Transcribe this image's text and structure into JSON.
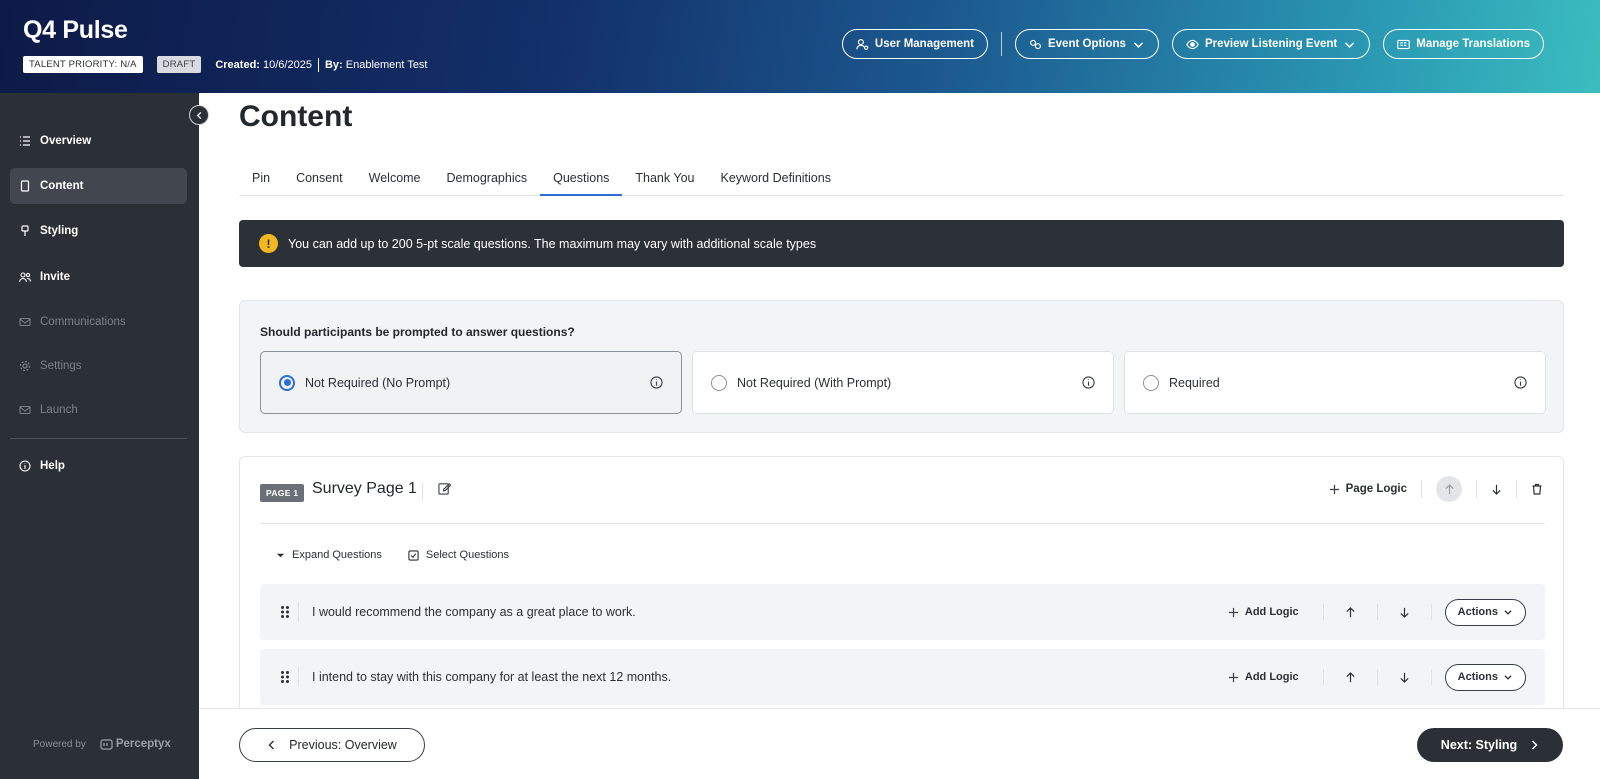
{
  "header": {
    "title": "Q4 Pulse",
    "talent_priority": "TALENT PRIORITY: N/A",
    "status": "DRAFT",
    "created_label": "Created:",
    "created_value": "10/6/2025",
    "by_label": "By:",
    "by_value": "Enablement Test",
    "buttons": {
      "user_management": "User Management",
      "event_options": "Event Options",
      "preview": "Preview Listening Event",
      "translations": "Manage Translations"
    }
  },
  "sidebar": {
    "items": [
      {
        "label": "Overview",
        "icon": "list-icon"
      },
      {
        "label": "Content",
        "icon": "document-icon"
      },
      {
        "label": "Styling",
        "icon": "brush-icon"
      },
      {
        "label": "Invite",
        "icon": "people-icon"
      },
      {
        "label": "Communications",
        "icon": "mail-icon"
      },
      {
        "label": "Settings",
        "icon": "gear-icon"
      },
      {
        "label": "Launch",
        "icon": "mail-icon"
      },
      {
        "label": "Help",
        "icon": "info-icon"
      }
    ],
    "powered_by": "Powered by",
    "brand": "Perceptyx"
  },
  "main": {
    "title": "Content",
    "tabs": [
      "Pin",
      "Consent",
      "Welcome",
      "Demographics",
      "Questions",
      "Thank You",
      "Keyword Definitions"
    ],
    "active_tab": "Questions",
    "banner": "You can add up to 200 5-pt scale questions. The maximum may vary with additional scale types",
    "prompt": {
      "question": "Should participants be prompted to answer questions?",
      "options": [
        "Not Required (No Prompt)",
        "Not Required (With Prompt)",
        "Required"
      ],
      "selected": "Not Required (No Prompt)"
    },
    "page": {
      "badge": "PAGE 1",
      "name": "Survey Page 1",
      "page_logic": "Page Logic",
      "expand_questions": "Expand Questions",
      "select_questions": "Select Questions",
      "add_logic": "Add Logic",
      "actions": "Actions",
      "questions": [
        "I would recommend the company as a great place to work.",
        "I intend to stay with this company for at least the next 12 months."
      ]
    }
  },
  "footer": {
    "previous": "Previous: Overview",
    "next": "Next: Styling"
  },
  "colors": {
    "accent": "#2c6ed5",
    "sidebar_bg": "#2b2f36",
    "warning": "#f3b81f"
  }
}
